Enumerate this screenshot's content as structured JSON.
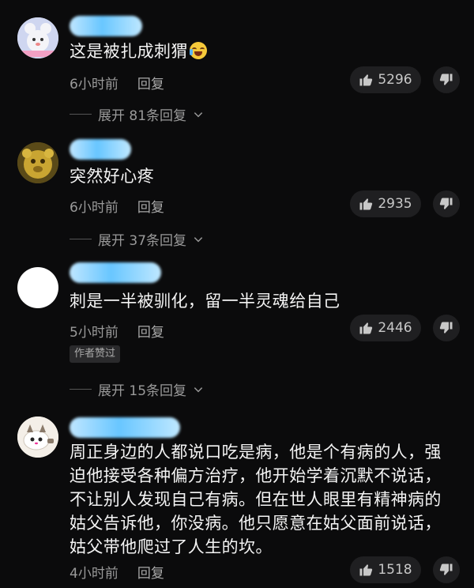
{
  "comments": [
    {
      "text": "这是被扎成刺猬",
      "emoji": "crying-laughing-emoji",
      "time": "6小时前",
      "reply": "回复",
      "likes": "5296",
      "expand": "展开 81条回复"
    },
    {
      "text": "突然好心疼",
      "time": "6小时前",
      "reply": "回复",
      "likes": "2935",
      "expand": "展开 37条回复"
    },
    {
      "text": "刺是一半被驯化，留一半灵魂给自己",
      "time": "5小时前",
      "reply": "回复",
      "likes": "2446",
      "badge": "作者赞过",
      "expand": "展开 15条回复"
    },
    {
      "text_lines": [
        "周正身边的人都说口吃是病，他是个有病的人，强",
        "迫他接受各种偏方治疗，他开始学着沉默不说话，",
        "不让别人发现自己有病。但在世人眼里有精神病的",
        "姑父告诉他，你没病。他只愿意在姑父面前说话，",
        "姑父带他爬过了人生的坎。"
      ],
      "time": "4小时前",
      "reply": "回复",
      "likes": "1518"
    }
  ],
  "icons": {
    "like": "thumbs-up-icon",
    "dislike": "thumbs-down-icon",
    "expand": "chevron-down-icon"
  },
  "colors": {
    "background": "#0b0b0c",
    "username_blur": "#68c6ff",
    "secondary_text": "#9a9a9a"
  }
}
